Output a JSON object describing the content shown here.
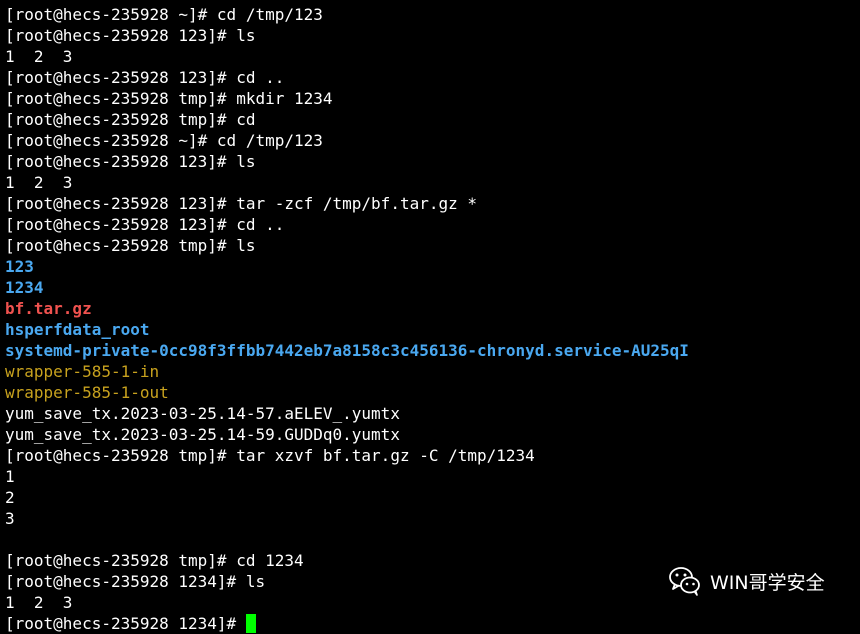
{
  "terminal": {
    "lines": [
      {
        "text": "[root@hecs-235928 ~]# cd /tmp/123",
        "color": "#ffffff",
        "bold": false
      },
      {
        "text": "[root@hecs-235928 123]# ls",
        "color": "#ffffff",
        "bold": false
      },
      {
        "text": "1  2  3",
        "color": "#ffffff",
        "bold": false
      },
      {
        "text": "[root@hecs-235928 123]# cd ..",
        "color": "#ffffff",
        "bold": false
      },
      {
        "text": "[root@hecs-235928 tmp]# mkdir 1234",
        "color": "#ffffff",
        "bold": false
      },
      {
        "text": "[root@hecs-235928 tmp]# cd",
        "color": "#ffffff",
        "bold": false
      },
      {
        "text": "[root@hecs-235928 ~]# cd /tmp/123",
        "color": "#ffffff",
        "bold": false
      },
      {
        "text": "[root@hecs-235928 123]# ls",
        "color": "#ffffff",
        "bold": false
      },
      {
        "text": "1  2  3",
        "color": "#ffffff",
        "bold": false
      },
      {
        "text": "[root@hecs-235928 123]# tar -zcf /tmp/bf.tar.gz *",
        "color": "#ffffff",
        "bold": false
      },
      {
        "text": "[root@hecs-235928 123]# cd ..",
        "color": "#ffffff",
        "bold": false
      },
      {
        "text": "[root@hecs-235928 tmp]# ls",
        "color": "#ffffff",
        "bold": false
      },
      {
        "text": "123",
        "color": "#4aa8f0",
        "bold": true
      },
      {
        "text": "1234",
        "color": "#4aa8f0",
        "bold": true
      },
      {
        "text": "bf.tar.gz",
        "color": "#f0524f",
        "bold": true
      },
      {
        "text": "hsperfdata_root",
        "color": "#4aa8f0",
        "bold": true
      },
      {
        "text": "systemd-private-0cc98f3ffbb7442eb7a8158c3c456136-chronyd.service-AU25qI",
        "color": "#4aa8f0",
        "bold": true
      },
      {
        "text": "wrapper-585-1-in",
        "color": "#c8a21e",
        "bold": false
      },
      {
        "text": "wrapper-585-1-out",
        "color": "#c8a21e",
        "bold": false
      },
      {
        "text": "yum_save_tx.2023-03-25.14-57.aELEV_.yumtx",
        "color": "#ffffff",
        "bold": false
      },
      {
        "text": "yum_save_tx.2023-03-25.14-59.GUDDq0.yumtx",
        "color": "#ffffff",
        "bold": false
      },
      {
        "text": "[root@hecs-235928 tmp]# tar xzvf bf.tar.gz -C /tmp/1234",
        "color": "#ffffff",
        "bold": false
      },
      {
        "text": "1",
        "color": "#ffffff",
        "bold": false
      },
      {
        "text": "2",
        "color": "#ffffff",
        "bold": false
      },
      {
        "text": "3",
        "color": "#ffffff",
        "bold": false
      },
      {
        "text": "",
        "color": "#ffffff",
        "bold": false
      },
      {
        "text": "[root@hecs-235928 tmp]# cd 1234",
        "color": "#ffffff",
        "bold": false
      },
      {
        "text": "[root@hecs-235928 1234]# ls",
        "color": "#ffffff",
        "bold": false
      },
      {
        "text": "1  2  3",
        "color": "#ffffff",
        "bold": false
      }
    ],
    "prompt": "[root@hecs-235928 1234]# ",
    "cursor_color": "#00ff00"
  },
  "watermark": {
    "text": "WIN哥学安全",
    "icon": "wechat-icon"
  }
}
